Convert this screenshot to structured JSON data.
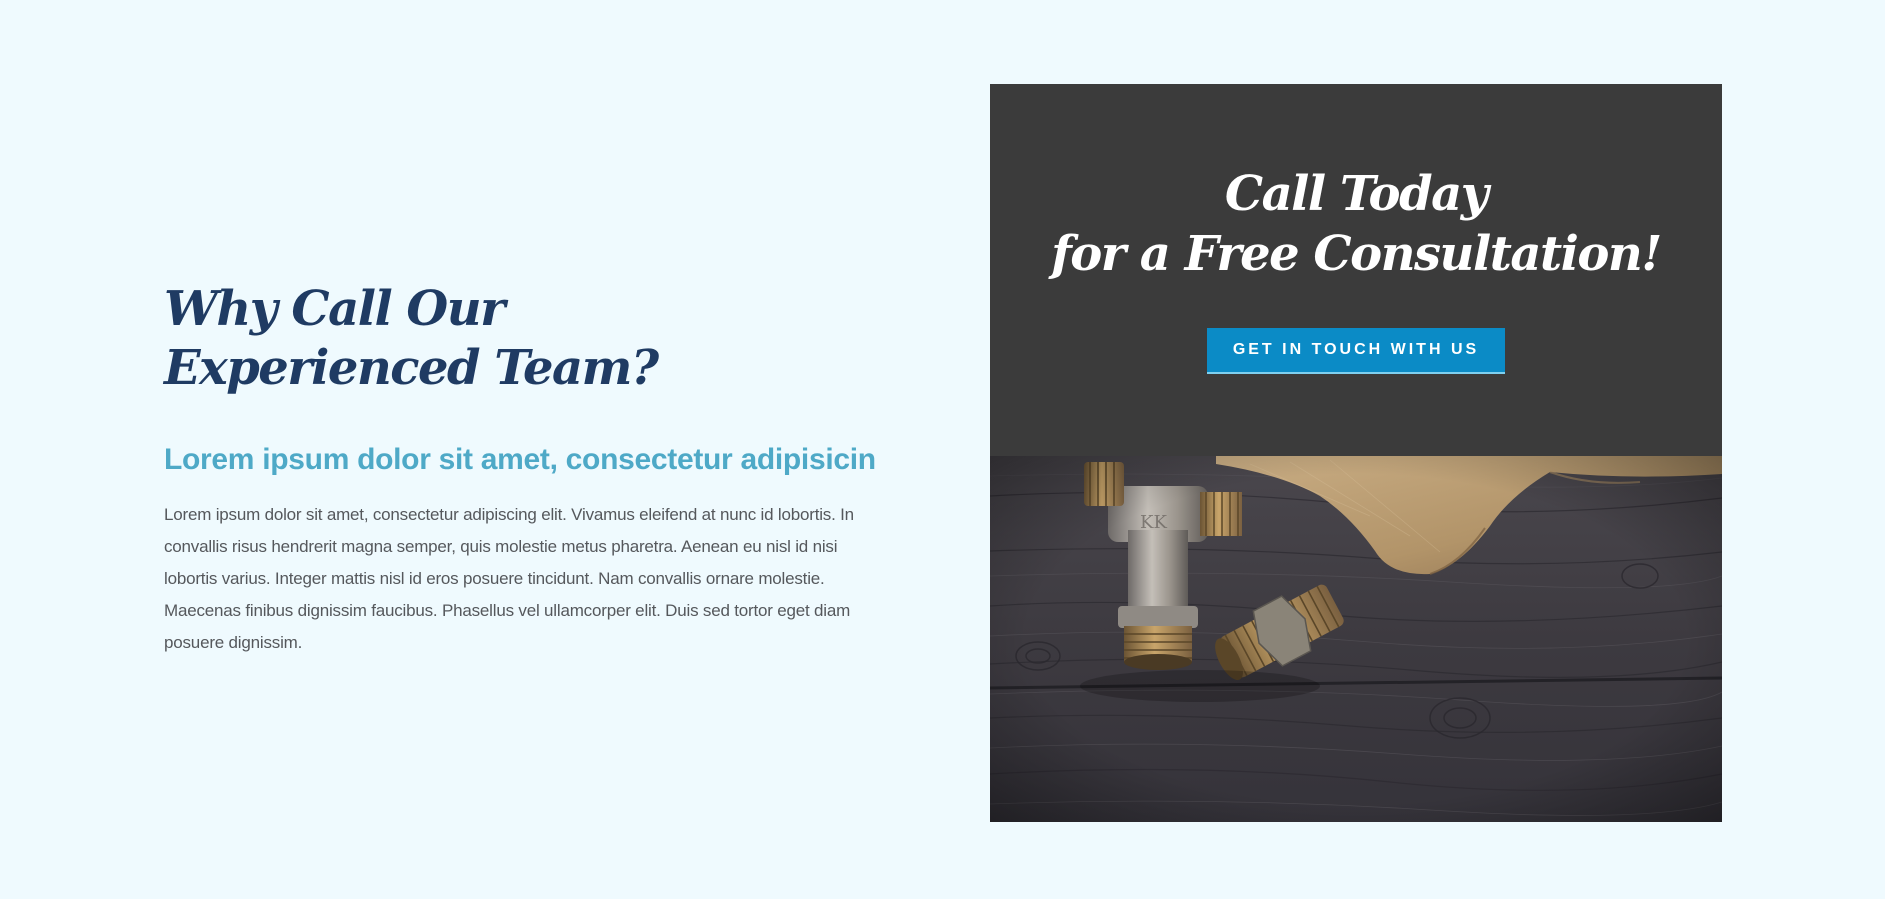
{
  "left": {
    "heading_line1": "Why Call Our",
    "heading_line2": "Experienced Team?",
    "subheading": "Lorem ipsum dolor sit amet, consectetur adipisicin",
    "body": "Lorem ipsum dolor sit amet, consectetur adipiscing elit. Vivamus eleifend at nunc id lobortis. In convallis risus hendrerit magna semper, quis molestie metus pharetra. Aenean eu nisl id nisi lobortis varius. Integer mattis nisl id eros posuere tincidunt. Nam convallis ornare molestie. Maecenas finibus dignissim faucibus. Phasellus vel ullamcorper elit. Duis sed tortor eget diam posuere dignissim."
  },
  "cta": {
    "heading_line1": "Call Today",
    "heading_line2": "for a Free Consultation!",
    "button_label": "GET IN TOUCH WITH US"
  },
  "colors": {
    "page_background": "#effafe",
    "heading": "#1f3b63",
    "subheading": "#4ea9c7",
    "body_text": "#55585c",
    "card_background": "#3b3b3b",
    "button": "#0b8bc6"
  },
  "image": {
    "subject": "plumbing-fittings-on-wood-photo"
  }
}
